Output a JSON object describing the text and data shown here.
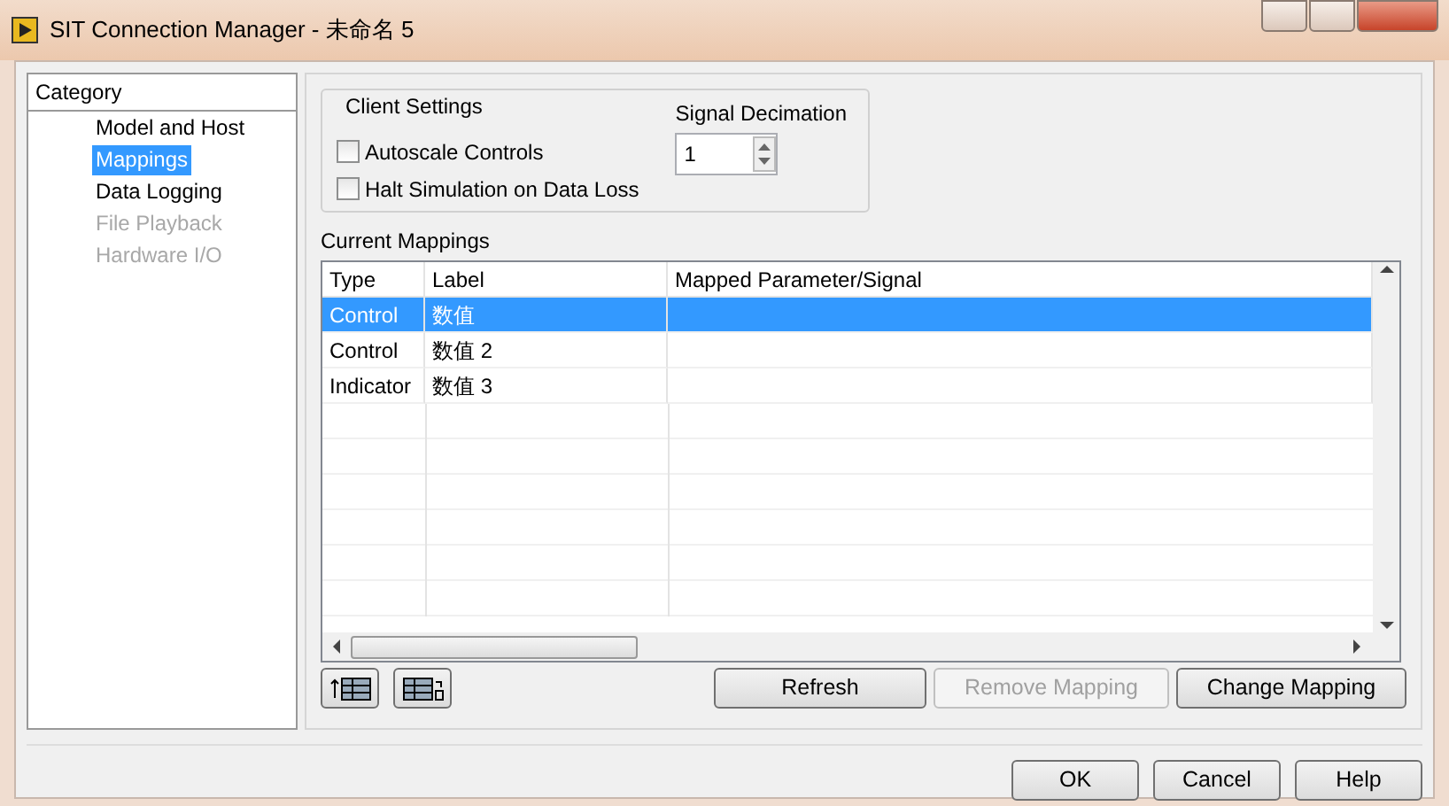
{
  "window": {
    "title": "SIT Connection Manager - 未命名 5"
  },
  "category": {
    "heading": "Category",
    "items": [
      {
        "label": "Model and Host",
        "selected": false,
        "disabled": false
      },
      {
        "label": "Mappings",
        "selected": true,
        "disabled": false
      },
      {
        "label": "Data Logging",
        "selected": false,
        "disabled": false
      },
      {
        "label": "File Playback",
        "selected": false,
        "disabled": true
      },
      {
        "label": "Hardware I/O",
        "selected": false,
        "disabled": true
      }
    ]
  },
  "client_settings": {
    "title": "Client Settings",
    "checkboxes": [
      {
        "label": "Autoscale Controls",
        "checked": false
      },
      {
        "label": "Halt Simulation on Data Loss",
        "checked": false
      }
    ],
    "decimation": {
      "label": "Signal Decimation",
      "value": "1"
    }
  },
  "mappings": {
    "title": "Current Mappings",
    "columns": [
      "Type",
      "Label",
      "Mapped Parameter/Signal"
    ],
    "rows": [
      {
        "cells": [
          "Control",
          "数值",
          ""
        ],
        "selected": true
      },
      {
        "cells": [
          "Control",
          "数值 2",
          ""
        ],
        "selected": false
      },
      {
        "cells": [
          "Indicator",
          "数值 3",
          ""
        ],
        "selected": false
      }
    ],
    "buttons": [
      {
        "label": "Refresh",
        "disabled": false
      },
      {
        "label": "Remove Mapping",
        "disabled": true
      },
      {
        "label": "Change Mapping",
        "disabled": false
      }
    ]
  },
  "footer_buttons": [
    "OK",
    "Cancel",
    "Help"
  ]
}
